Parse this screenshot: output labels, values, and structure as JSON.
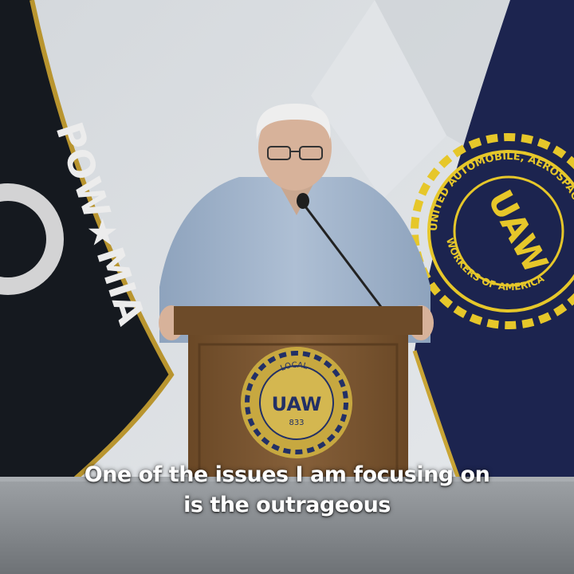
{
  "captions": {
    "line1": "One of the issues I am focusing on",
    "line2": "is the outrageous"
  },
  "flags": {
    "left": {
      "text": "POW-MIA",
      "color": "#161a20"
    },
    "right": {
      "center_text": "UAW",
      "ring_top_text": "UNITED AUTOMOBILE, AEROSPACE & AGRICULTURAL",
      "ring_bottom_text": "WORKERS OF AMERICA",
      "color": "#1b2350",
      "emblem_color": "#e6c72a"
    }
  },
  "podium": {
    "seal_center_text": "UAW",
    "seal_top_text": "LOCAL",
    "seal_bottom_text": "833",
    "color": "#7a5530",
    "seal_color": "#c7a840"
  },
  "colors": {
    "backdrop": "#d9dde1",
    "table_cloth": "#8b8f93",
    "shirt": "#9fb3cc"
  }
}
